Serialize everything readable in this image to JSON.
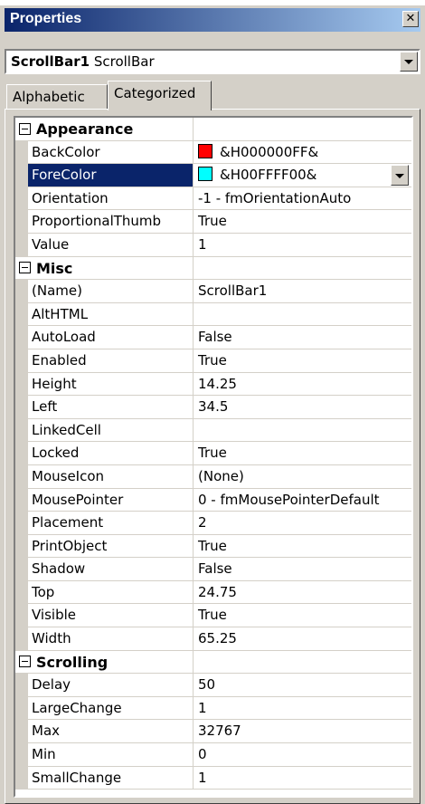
{
  "window": {
    "title": "Properties",
    "close_glyph": "✕"
  },
  "object_selector": {
    "name": "ScrollBar1",
    "type": "ScrollBar"
  },
  "tabs": [
    {
      "label": "Alphabetic"
    },
    {
      "label": "Categorized"
    }
  ],
  "colors": {
    "backcolor_swatch": "#ff0000",
    "forecolor_swatch": "#00ffff",
    "selection": "#0a246a",
    "title_gradient_start": "#0a246a"
  },
  "categories": [
    {
      "label": "Appearance",
      "props": [
        {
          "name": "BackColor",
          "value": "&H000000FF&"
        },
        {
          "name": "ForeColor",
          "value": "&H00FFFF00&"
        },
        {
          "name": "Orientation",
          "value": "-1 - fmOrientationAuto"
        },
        {
          "name": "ProportionalThumb",
          "value": "True"
        },
        {
          "name": "Value",
          "value": "1"
        }
      ]
    },
    {
      "label": "Misc",
      "props": [
        {
          "name": "(Name)",
          "value": "ScrollBar1"
        },
        {
          "name": "AltHTML",
          "value": ""
        },
        {
          "name": "AutoLoad",
          "value": "False"
        },
        {
          "name": "Enabled",
          "value": "True"
        },
        {
          "name": "Height",
          "value": "14.25"
        },
        {
          "name": "Left",
          "value": "34.5"
        },
        {
          "name": "LinkedCell",
          "value": ""
        },
        {
          "name": "Locked",
          "value": "True"
        },
        {
          "name": "MouseIcon",
          "value": "(None)"
        },
        {
          "name": "MousePointer",
          "value": "0 - fmMousePointerDefault"
        },
        {
          "name": "Placement",
          "value": "2"
        },
        {
          "name": "PrintObject",
          "value": "True"
        },
        {
          "name": "Shadow",
          "value": "False"
        },
        {
          "name": "Top",
          "value": "24.75"
        },
        {
          "name": "Visible",
          "value": "True"
        },
        {
          "name": "Width",
          "value": "65.25"
        }
      ]
    },
    {
      "label": "Scrolling",
      "props": [
        {
          "name": "Delay",
          "value": "50"
        },
        {
          "name": "LargeChange",
          "value": "1"
        },
        {
          "name": "Max",
          "value": "32767"
        },
        {
          "name": "Min",
          "value": "0"
        },
        {
          "name": "SmallChange",
          "value": "1"
        }
      ]
    }
  ]
}
